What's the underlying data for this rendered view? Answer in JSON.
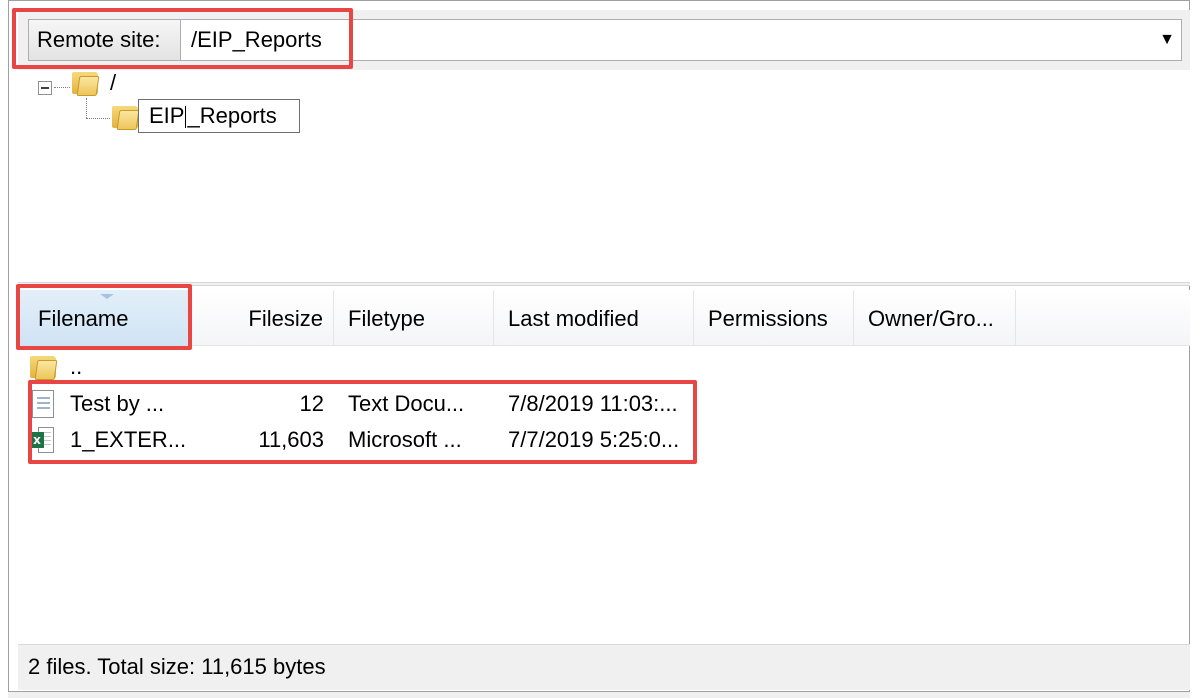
{
  "remote_site": {
    "label": "Remote site:",
    "path": "/EIP_Reports",
    "dropdown_arrow": "▼"
  },
  "tree": {
    "root_label": "/",
    "edit_before": "EIP",
    "edit_after": "_Reports"
  },
  "list": {
    "columns": [
      "Filename",
      "Filesize",
      "Filetype",
      "Last modified",
      "Permissions",
      "Owner/Gro..."
    ],
    "parent_row": {
      "name": ".."
    },
    "rows": [
      {
        "icon": "text-document-icon",
        "name": "Test by ...",
        "size": "12",
        "type": "Text Docu...",
        "modified": "7/8/2019 11:03:..."
      },
      {
        "icon": "excel-file-icon",
        "name": "1_EXTER...",
        "size": "11,603",
        "type": "Microsoft ...",
        "modified": "7/7/2019 5:25:0..."
      }
    ]
  },
  "status": {
    "text": "2 files. Total size: 11,615 bytes"
  },
  "colors": {
    "highlight": "#e84545",
    "sorted_header": "#cfe3f5",
    "excel_green": "#1f7244"
  }
}
